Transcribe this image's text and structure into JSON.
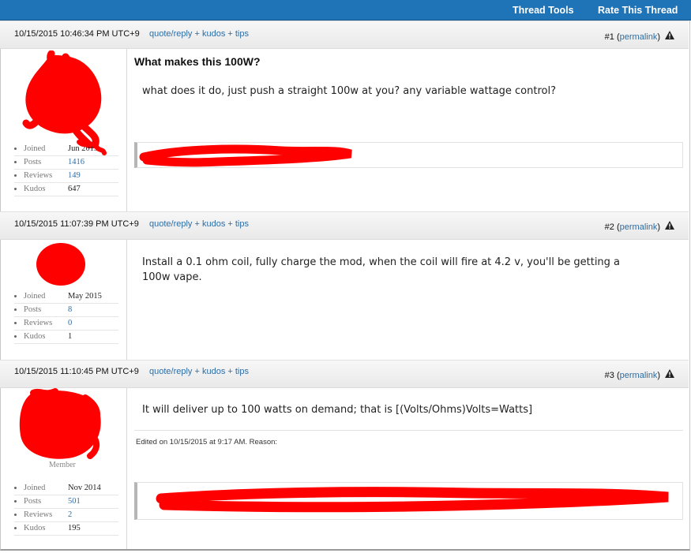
{
  "toolbar": {
    "thread_tools": "Thread Tools",
    "rate_thread": "Rate This Thread"
  },
  "colors": {
    "toolbar_bg": "#1f73b7",
    "link": "#2e6da4",
    "redaction": "#ff0000"
  },
  "posts": [
    {
      "date": "10/15/2015 10:46:34 PM UTC+9",
      "quote_link": "quote/reply + kudos + tips",
      "number": "#1",
      "permalink": "permalink",
      "title": "What makes this 100W?",
      "body": "what does it do, just push a straight 100w at you? any variable wattage control?",
      "stats": [
        {
          "label": "Joined",
          "value": "Jun 2013"
        },
        {
          "label": "Posts",
          "value": "1416"
        },
        {
          "label": "Reviews",
          "value": "149"
        },
        {
          "label": "Kudos",
          "value": "647"
        }
      ]
    },
    {
      "date": "10/15/2015 11:07:39 PM UTC+9",
      "quote_link": "quote/reply + kudos + tips",
      "number": "#2",
      "permalink": "permalink",
      "body_line1": "Install a 0.1 ohm coil, fully charge the mod, when the coil will fire at 4.2 v, you'll be getting a",
      "body_line2": "100w vape.",
      "stats": [
        {
          "label": "Joined",
          "value": "May 2015"
        },
        {
          "label": "Posts",
          "value": "8"
        },
        {
          "label": "Reviews",
          "value": "0"
        },
        {
          "label": "Kudos",
          "value": "1"
        }
      ]
    },
    {
      "date": "10/15/2015 11:10:45 PM UTC+9",
      "quote_link": "quote/reply + kudos + tips",
      "number": "#3",
      "permalink": "permalink",
      "body": "It will deliver up to 100 watts on demand; that is [(Volts/Ohms)Volts=Watts]",
      "edited": "Edited on 10/15/2015 at 9:17 AM. Reason:",
      "member_title": "Member",
      "stats": [
        {
          "label": "Joined",
          "value": "Nov 2014"
        },
        {
          "label": "Posts",
          "value": "501"
        },
        {
          "label": "Reviews",
          "value": "2"
        },
        {
          "label": "Kudos",
          "value": "195"
        }
      ]
    }
  ]
}
